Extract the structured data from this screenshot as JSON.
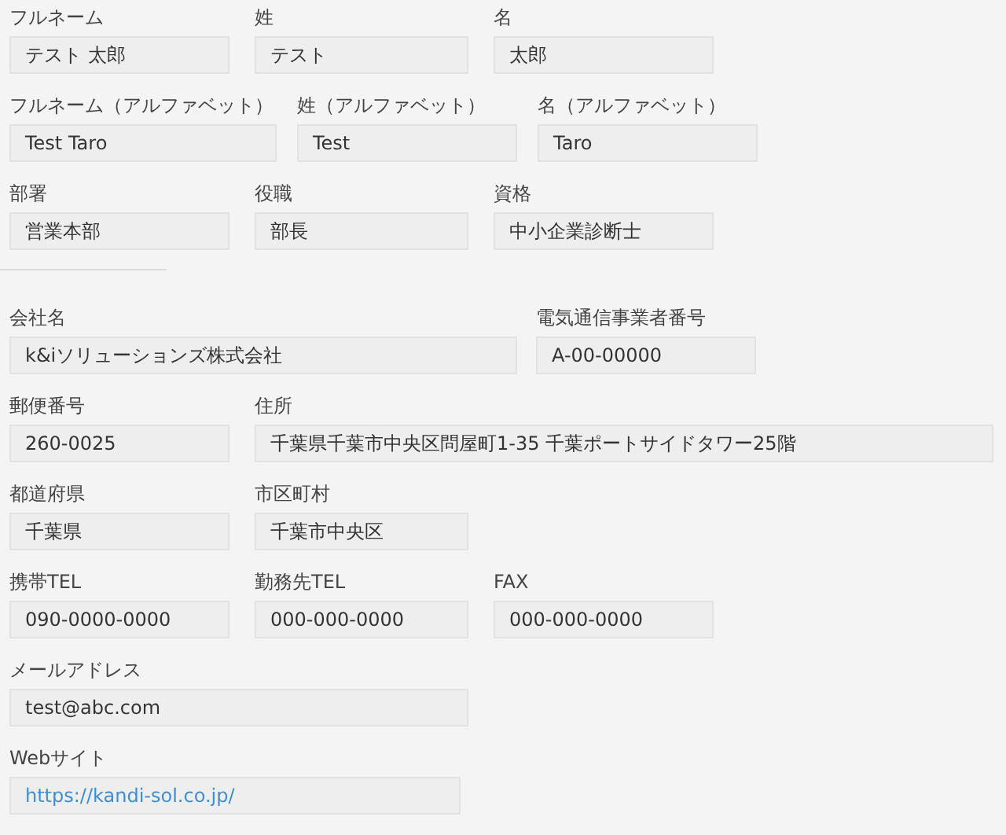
{
  "sections": [
    {
      "rows": [
        [
          {
            "label": "フルネーム",
            "value": "テスト 太郎",
            "kind": "text"
          },
          {
            "label": "姓",
            "value": "テスト",
            "kind": "text"
          },
          {
            "label": "名",
            "value": "太郎",
            "kind": "text"
          }
        ],
        [
          {
            "label": "フルネーム（アルファベット）",
            "value": "Test Taro",
            "kind": "text"
          },
          {
            "label": "姓（アルファベット）",
            "value": "Test",
            "kind": "text"
          },
          {
            "label": "名（アルファベット）",
            "value": "Taro",
            "kind": "text"
          }
        ],
        [
          {
            "label": "部署",
            "value": "営業本部",
            "kind": "text"
          },
          {
            "label": "役職",
            "value": "部長",
            "kind": "text"
          },
          {
            "label": "資格",
            "value": "中小企業診断士",
            "kind": "text"
          }
        ]
      ]
    },
    {
      "rows": [
        [
          {
            "label": "会社名",
            "value": "k&iソリューションズ株式会社",
            "kind": "text"
          },
          {
            "label": "電気通信事業者番号",
            "value": "A-00-00000",
            "kind": "text"
          }
        ],
        [
          {
            "label": "郵便番号",
            "value": "260-0025",
            "kind": "text"
          },
          {
            "label": "住所",
            "value": "千葉県千葉市中央区問屋町1-35 千葉ポートサイドタワー25階",
            "kind": "text"
          }
        ],
        [
          {
            "label": "都道府県",
            "value": "千葉県",
            "kind": "text"
          },
          {
            "label": "市区町村",
            "value": "千葉市中央区",
            "kind": "text"
          }
        ],
        [
          {
            "label": "携帯TEL",
            "value": "090-0000-0000",
            "kind": "text"
          },
          {
            "label": "勤務先TEL",
            "value": "000-000-0000",
            "kind": "text"
          },
          {
            "label": "FAX",
            "value": "000-000-0000",
            "kind": "text"
          }
        ],
        [
          {
            "label": "メールアドレス",
            "value": "test@abc.com",
            "kind": "text"
          }
        ],
        [
          {
            "label": "Webサイト",
            "value": "https://kandi-sol.co.jp/",
            "kind": "link"
          }
        ]
      ]
    }
  ]
}
